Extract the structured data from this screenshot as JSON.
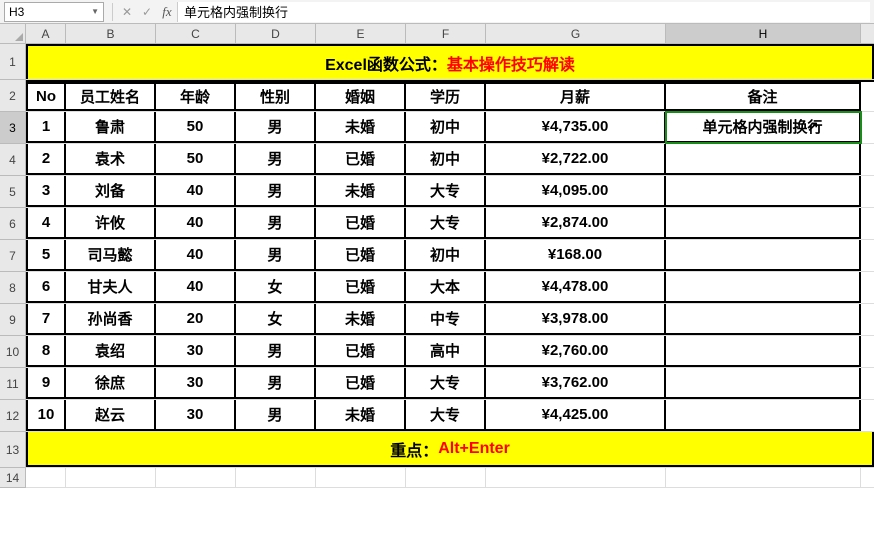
{
  "formula_bar": {
    "name_box": "H3",
    "cancel": "✕",
    "confirm": "✓",
    "fx": "fx",
    "value": "单元格内强制换行"
  },
  "columns": [
    "A",
    "B",
    "C",
    "D",
    "E",
    "F",
    "G",
    "H"
  ],
  "row_numbers": [
    "1",
    "2",
    "3",
    "4",
    "5",
    "6",
    "7",
    "8",
    "9",
    "10",
    "11",
    "12",
    "13",
    "14"
  ],
  "active_cell": "H3",
  "title": {
    "black": "Excel函数公式：",
    "red": "基本操作技巧解读"
  },
  "headers": {
    "no": "No",
    "name": "员工姓名",
    "age": "年龄",
    "gender": "性别",
    "marriage": "婚姻",
    "edu": "学历",
    "salary": "月薪",
    "note": "备注"
  },
  "footer": {
    "black": "重点：",
    "red": "Alt+Enter"
  },
  "note_value": "单元格内强制换行",
  "chart_data": {
    "type": "table",
    "columns": [
      "No",
      "员工姓名",
      "年龄",
      "性别",
      "婚姻",
      "学历",
      "月薪",
      "备注"
    ],
    "rows": [
      {
        "no": "1",
        "name": "鲁肃",
        "age": "50",
        "gender": "男",
        "marriage": "未婚",
        "edu": "初中",
        "salary": "¥4,735.00",
        "note": "单元格内强制换行"
      },
      {
        "no": "2",
        "name": "袁术",
        "age": "50",
        "gender": "男",
        "marriage": "已婚",
        "edu": "初中",
        "salary": "¥2,722.00",
        "note": ""
      },
      {
        "no": "3",
        "name": "刘备",
        "age": "40",
        "gender": "男",
        "marriage": "未婚",
        "edu": "大专",
        "salary": "¥4,095.00",
        "note": ""
      },
      {
        "no": "4",
        "name": "许攸",
        "age": "40",
        "gender": "男",
        "marriage": "已婚",
        "edu": "大专",
        "salary": "¥2,874.00",
        "note": ""
      },
      {
        "no": "5",
        "name": "司马懿",
        "age": "40",
        "gender": "男",
        "marriage": "已婚",
        "edu": "初中",
        "salary": "¥168.00",
        "note": ""
      },
      {
        "no": "6",
        "name": "甘夫人",
        "age": "40",
        "gender": "女",
        "marriage": "已婚",
        "edu": "大本",
        "salary": "¥4,478.00",
        "note": ""
      },
      {
        "no": "7",
        "name": "孙尚香",
        "age": "20",
        "gender": "女",
        "marriage": "未婚",
        "edu": "中专",
        "salary": "¥3,978.00",
        "note": ""
      },
      {
        "no": "8",
        "name": "袁绍",
        "age": "30",
        "gender": "男",
        "marriage": "已婚",
        "edu": "高中",
        "salary": "¥2,760.00",
        "note": ""
      },
      {
        "no": "9",
        "name": "徐庶",
        "age": "30",
        "gender": "男",
        "marriage": "已婚",
        "edu": "大专",
        "salary": "¥3,762.00",
        "note": ""
      },
      {
        "no": "10",
        "name": "赵云",
        "age": "30",
        "gender": "男",
        "marriage": "未婚",
        "edu": "大专",
        "salary": "¥4,425.00",
        "note": ""
      }
    ]
  }
}
